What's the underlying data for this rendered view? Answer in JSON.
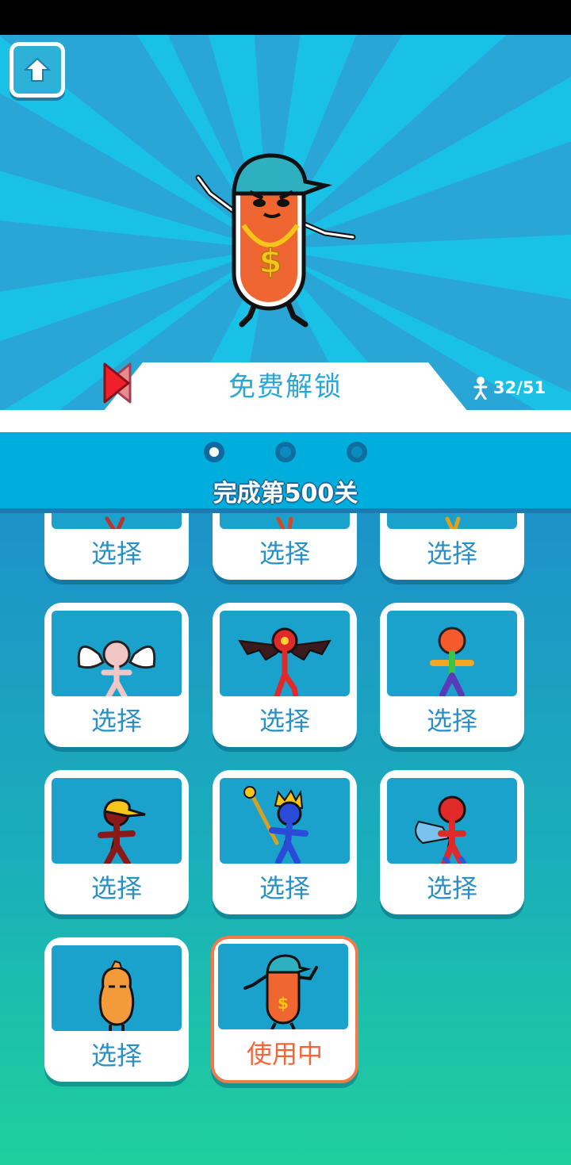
{
  "hero": {
    "unlock_label": "免费解锁",
    "unlock_count": "32/51",
    "current_character_icon": "sausage-rapper-character"
  },
  "task": {
    "page_dots": 3,
    "active_page": 1,
    "title": "完成第500关"
  },
  "grid": {
    "select_label": "选择",
    "in_use_label": "使用中",
    "rows": [
      [
        {
          "icon": "stick-figure-partial",
          "label": "选择"
        },
        {
          "icon": "stick-figure-partial",
          "label": "选择"
        },
        {
          "icon": "stick-figure-partial",
          "label": "选择"
        }
      ],
      [
        {
          "icon": "angel-stick-figure",
          "label": "选择"
        },
        {
          "icon": "demon-bat-stick-figure",
          "label": "选择"
        },
        {
          "icon": "rainbow-stick-figure",
          "label": "选择"
        }
      ],
      [
        {
          "icon": "cap-stick-figure",
          "label": "选择"
        },
        {
          "icon": "king-stick-figure",
          "label": "选择"
        },
        {
          "icon": "superhero-stick-figure",
          "label": "选择"
        }
      ],
      [
        {
          "icon": "peanut-character",
          "label": "选择"
        },
        {
          "icon": "sausage-rapper-character",
          "label": "使用中"
        }
      ]
    ]
  },
  "colors": {
    "sky": "#2aa6d6",
    "panel_top": "#00b2de",
    "panel_bottom": "#1fd09c",
    "select_text": "#2a8fc4",
    "in_use": "#f0683a"
  }
}
